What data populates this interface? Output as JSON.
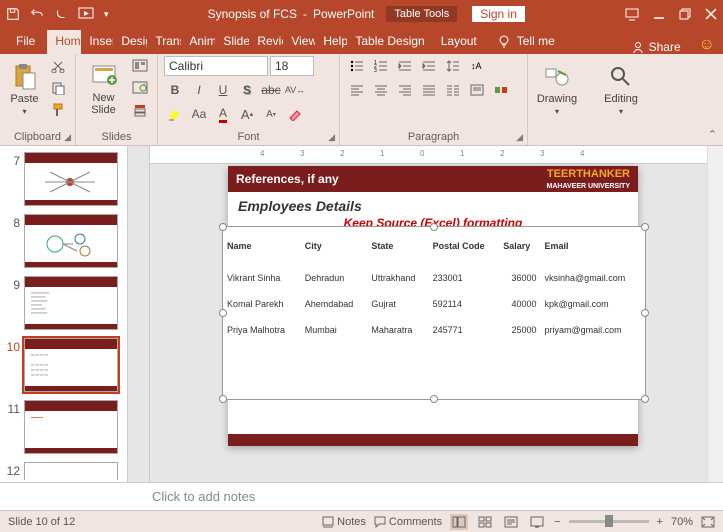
{
  "titlebar": {
    "doc_title": "Synopsis of FCS",
    "app_name": "PowerPoint",
    "context_tab": "Table Tools",
    "signin": "Sign in"
  },
  "menu": {
    "file": "File",
    "home": "Home",
    "insert": "Insert",
    "design": "Design",
    "transitions": "Transitions",
    "animations": "Animations",
    "slideshow": "Slide Show",
    "review": "Review",
    "view": "View",
    "help": "Help",
    "table_design": "Table Design",
    "layout": "Layout",
    "tellme": "Tell me",
    "share": "Share"
  },
  "ribbon": {
    "clipboard": {
      "label": "Clipboard",
      "paste": "Paste"
    },
    "slides": {
      "label": "Slides",
      "new_slide": "New\nSlide"
    },
    "font": {
      "label": "Font",
      "name": "Calibri",
      "size": "18"
    },
    "paragraph": {
      "label": "Paragraph"
    },
    "drawing": {
      "label": "Drawing",
      "btn": "Drawing"
    },
    "editing": {
      "label": "Editing",
      "btn": "Editing"
    }
  },
  "thumbs": {
    "visible": [
      "7",
      "8",
      "9",
      "10",
      "11",
      "12"
    ],
    "active": "10"
  },
  "slide": {
    "header": "References, if any",
    "uni_name": "TEERTHANKER",
    "uni_sub": "MAHAVEER UNIVERSITY",
    "title": "Employees Details",
    "subtitle": "Keep Source (Excel) formatting",
    "columns": [
      "Name",
      "City",
      "State",
      "Postal Code",
      "Salary",
      "Email"
    ],
    "rows": [
      {
        "name": "Vikrant Sinha",
        "city": "Dehradun",
        "state": "Uttrakhand",
        "postal": "233001",
        "salary": "36000",
        "email": "vksinha@gmail.com"
      },
      {
        "name": "Komal Parekh",
        "city": "Ahemdabad",
        "state": "Gujrat",
        "postal": "592114",
        "salary": "40000",
        "email": "kpk@gmail.com"
      },
      {
        "name": "Priya Malhotra",
        "city": "Mumbai",
        "state": "Maharatra",
        "postal": "245771",
        "salary": "25000",
        "email": "priyam@gmail.com"
      }
    ]
  },
  "notes": {
    "placeholder": "Click to add notes"
  },
  "status": {
    "slide_info": "Slide 10 of 12",
    "notes": "Notes",
    "comments": "Comments",
    "zoom": "70%"
  }
}
